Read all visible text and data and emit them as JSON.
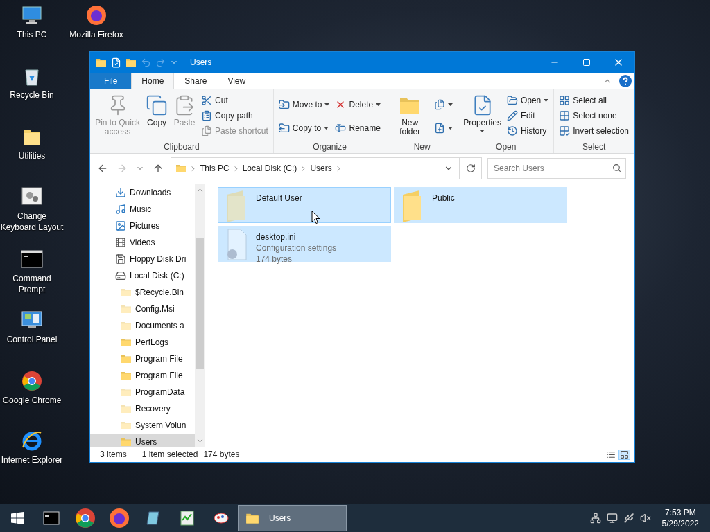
{
  "desktop_icons": [
    {
      "label": "This PC",
      "kind": "pc"
    },
    {
      "label": "Mozilla Firefox",
      "kind": "firefox"
    },
    {
      "label": "Recycle Bin",
      "kind": "recycle"
    },
    {
      "label": "Utilities",
      "kind": "folder"
    },
    {
      "label": "Change Keyboard Layout",
      "kind": "keyboard"
    },
    {
      "label": "Command Prompt",
      "kind": "cmd"
    },
    {
      "label": "Control Panel",
      "kind": "control"
    },
    {
      "label": "Google Chrome",
      "kind": "chrome"
    },
    {
      "label": "Internet Explorer",
      "kind": "ie"
    }
  ],
  "window": {
    "title": "Users",
    "tabs": [
      {
        "label": "File",
        "kind": "file",
        "selected": false
      },
      {
        "label": "Home",
        "kind": "tab",
        "selected": true
      },
      {
        "label": "Share",
        "kind": "tab",
        "selected": false
      },
      {
        "label": "View",
        "kind": "tab",
        "selected": false
      }
    ],
    "ribbon_groups": [
      {
        "label": "Clipboard",
        "columns": [
          {
            "kind": "large",
            "buttons": [
              {
                "label": "Pin to Quick access",
                "disabled": true,
                "dropdown": false
              }
            ]
          },
          {
            "kind": "large",
            "buttons": [
              {
                "label": "Copy",
                "disabled": false,
                "dropdown": false
              }
            ]
          },
          {
            "kind": "large",
            "buttons": [
              {
                "label": "Paste",
                "disabled": true,
                "dropdown": false
              }
            ]
          },
          {
            "kind": "stack",
            "buttons": [
              {
                "label": "Cut",
                "disabled": false,
                "dropdown": false
              },
              {
                "label": "Copy path",
                "disabled": false,
                "dropdown": false
              },
              {
                "label": "Paste shortcut",
                "disabled": true,
                "dropdown": false
              }
            ]
          }
        ]
      },
      {
        "label": "Organize",
        "columns": [
          {
            "kind": "stack",
            "buttons": [
              {
                "label": "Move to",
                "disabled": false,
                "dropdown": true
              },
              {
                "label": "Copy to",
                "disabled": false,
                "dropdown": true
              }
            ]
          },
          {
            "kind": "stack",
            "buttons": [
              {
                "label": "Delete",
                "disabled": false,
                "dropdown": true
              },
              {
                "label": "Rename",
                "disabled": false,
                "dropdown": false
              }
            ]
          }
        ]
      },
      {
        "label": "New",
        "columns": [
          {
            "kind": "large",
            "buttons": [
              {
                "label": "New folder",
                "disabled": false,
                "dropdown": false
              }
            ]
          },
          {
            "kind": "iconstack",
            "buttons": [
              {
                "disabled": false,
                "dropdown": true
              },
              {
                "disabled": false,
                "dropdown": true
              }
            ]
          }
        ]
      },
      {
        "label": "Open",
        "columns": [
          {
            "kind": "large",
            "buttons": [
              {
                "label": "Properties",
                "disabled": false,
                "dropdown": true
              }
            ]
          },
          {
            "kind": "stack",
            "buttons": [
              {
                "label": "Open",
                "disabled": false,
                "dropdown": true
              },
              {
                "label": "Edit",
                "disabled": false,
                "dropdown": false
              },
              {
                "label": "History",
                "disabled": false,
                "dropdown": false
              }
            ]
          }
        ]
      },
      {
        "label": "Select",
        "columns": [
          {
            "kind": "stack",
            "buttons": [
              {
                "label": "Select all",
                "disabled": false,
                "dropdown": false
              },
              {
                "label": "Select none",
                "disabled": false,
                "dropdown": false
              },
              {
                "label": "Invert selection",
                "disabled": false,
                "dropdown": false
              }
            ]
          }
        ]
      }
    ],
    "address": {
      "breadcrumb": [
        "This PC",
        "Local Disk (C:)",
        "Users"
      ],
      "search_placeholder": "Search Users",
      "forward_disabled": true
    },
    "nav_pane": [
      {
        "label": "Downloads",
        "kind": "downloads",
        "selected": false
      },
      {
        "label": "Music",
        "kind": "music",
        "selected": false
      },
      {
        "label": "Pictures",
        "kind": "pictures",
        "selected": false
      },
      {
        "label": "Videos",
        "kind": "videos",
        "selected": false
      },
      {
        "label": "Floppy Disk Dri",
        "kind": "floppy",
        "selected": false
      },
      {
        "label": "Local Disk (C:)",
        "kind": "disk",
        "selected": false,
        "children": [
          {
            "label": "$Recycle.Bin",
            "kind": "folder",
            "hidden": true,
            "selected": false
          },
          {
            "label": "Config.Msi",
            "kind": "folder",
            "hidden": true,
            "selected": false
          },
          {
            "label": "Documents a",
            "kind": "folder",
            "hidden": true,
            "selected": false
          },
          {
            "label": "PerfLogs",
            "kind": "folder",
            "hidden": false,
            "selected": false
          },
          {
            "label": "Program File",
            "kind": "folder",
            "hidden": false,
            "selected": false
          },
          {
            "label": "Program File",
            "kind": "folder",
            "hidden": false,
            "selected": false
          },
          {
            "label": "ProgramData",
            "kind": "folder",
            "hidden": true,
            "selected": false
          },
          {
            "label": "Recovery",
            "kind": "folder",
            "hidden": true,
            "selected": false
          },
          {
            "label": "System Volun",
            "kind": "folder",
            "hidden": true,
            "selected": false
          },
          {
            "label": "Users",
            "kind": "folder",
            "hidden": false,
            "selected": true
          }
        ]
      }
    ],
    "items": [
      {
        "name": "Default User",
        "kind": "folder",
        "hidden": true,
        "selected": true,
        "focused": true
      },
      {
        "name": "Public",
        "kind": "folder",
        "hidden": false,
        "selected": true,
        "focused": false
      },
      {
        "name": "desktop.ini",
        "kind": "file",
        "hidden": true,
        "selected": true,
        "focused": false,
        "details": [
          "Configuration settings",
          "174 bytes"
        ]
      }
    ],
    "status_bar": {
      "count": "3 items",
      "selection": "1 item selected",
      "size": "174 bytes",
      "view_large_selected": true
    }
  },
  "taskbar": {
    "buttons": [
      {
        "kind": "cmd",
        "selected": false
      },
      {
        "kind": "chrome",
        "selected": false
      },
      {
        "kind": "firefox",
        "selected": false
      },
      {
        "kind": "notepad",
        "selected": false
      },
      {
        "kind": "taskman",
        "selected": false
      },
      {
        "kind": "paint",
        "selected": false
      },
      {
        "kind": "window",
        "label": "Users",
        "selected": true
      }
    ],
    "time": "7:53 PM",
    "date": "5/29/2022"
  }
}
